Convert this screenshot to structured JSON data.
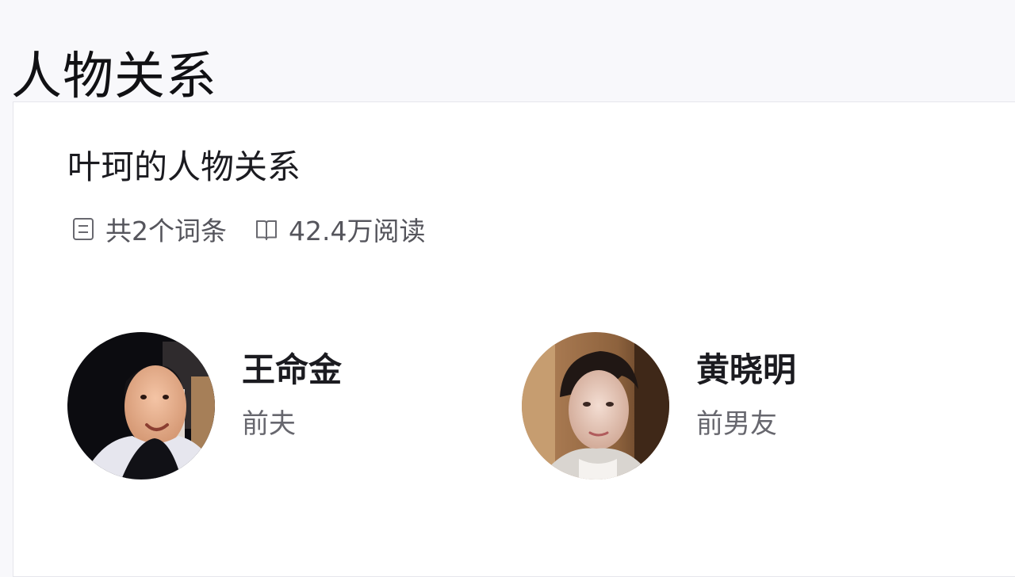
{
  "page": {
    "title": "人物关系"
  },
  "card": {
    "title": "叶珂的人物关系",
    "stats": {
      "entries": "共2个词条",
      "reads": "42.4万阅读"
    },
    "people": [
      {
        "name": "王命金",
        "relation": "前夫"
      },
      {
        "name": "黄晓明",
        "relation": "前男友"
      }
    ]
  },
  "colors": {
    "background": "#f8f8fb",
    "card": "#ffffff",
    "text_primary": "#1b1b20",
    "text_secondary": "#67676e"
  },
  "icons": [
    "document-icon",
    "book-icon",
    "avatar-placeholder"
  ]
}
